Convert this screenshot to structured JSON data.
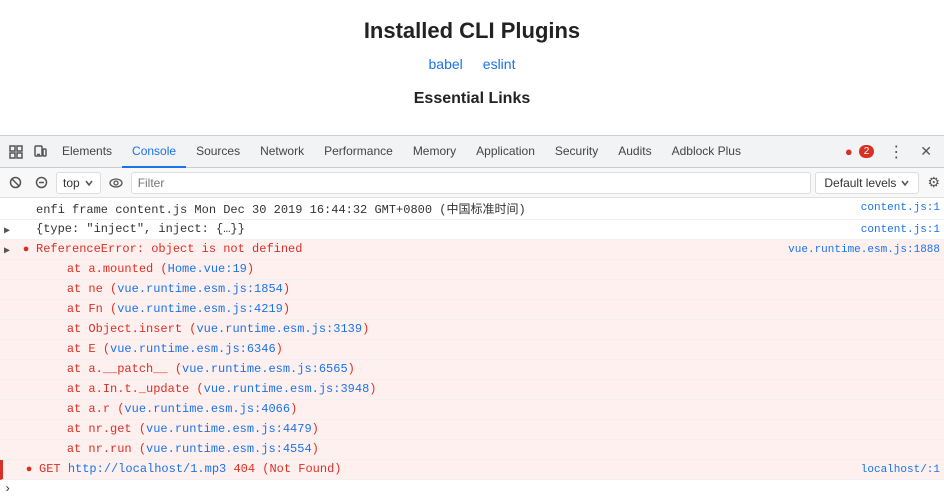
{
  "page": {
    "title": "Installed CLI Plugins",
    "links": [
      {
        "label": "babel",
        "href": "#"
      },
      {
        "label": "eslint",
        "href": "#"
      }
    ],
    "essential_partial": "Essential Links"
  },
  "devtools": {
    "tabs": [
      {
        "label": "Elements",
        "active": false
      },
      {
        "label": "Console",
        "active": true
      },
      {
        "label": "Sources",
        "active": false
      },
      {
        "label": "Network",
        "active": false
      },
      {
        "label": "Performance",
        "active": false
      },
      {
        "label": "Memory",
        "active": false
      },
      {
        "label": "Application",
        "active": false
      },
      {
        "label": "Security",
        "active": false
      },
      {
        "label": "Audits",
        "active": false
      },
      {
        "label": "Adblock Plus",
        "active": false
      }
    ],
    "error_badge": "2",
    "console": {
      "context": "top",
      "filter_placeholder": "Filter",
      "levels": "Default levels",
      "lines": [
        {
          "type": "info",
          "text": "enfi frame content.js Mon Dec 30 2019 16:44:32 GMT+0800 (中国标准时间)",
          "file": "content.js:1"
        },
        {
          "type": "object",
          "text": "▶ {type: \"inject\", inject: {…}}",
          "file": "content.js:1"
        },
        {
          "type": "error-header",
          "text": "▶ ● ReferenceError: object is not defined",
          "file": "vue.runtime.esm.js:1888",
          "stack": [
            "    at a.mounted (Home.vue:19)",
            "    at ne (vue.runtime.esm.js:1854)",
            "    at Fn (vue.runtime.esm.js:4219)",
            "    at Object.insert (vue.runtime.esm.js:3139)",
            "    at E (vue.runtime.esm.js:6346)",
            "    at a.__patch__ (vue.runtime.esm.js:6565)",
            "    at a.In.t._update (vue.runtime.esm.js:3948)",
            "    at a.r (vue.runtime.esm.js:4066)",
            "    at nr.get (vue.runtime.esm.js:4479)",
            "    at nr.run (vue.runtime.esm.js:4554)"
          ]
        },
        {
          "type": "get-error",
          "text": "● GET http://localhost/1.mp3 404 (Not Found)",
          "file": "localhost/:1"
        }
      ]
    }
  }
}
